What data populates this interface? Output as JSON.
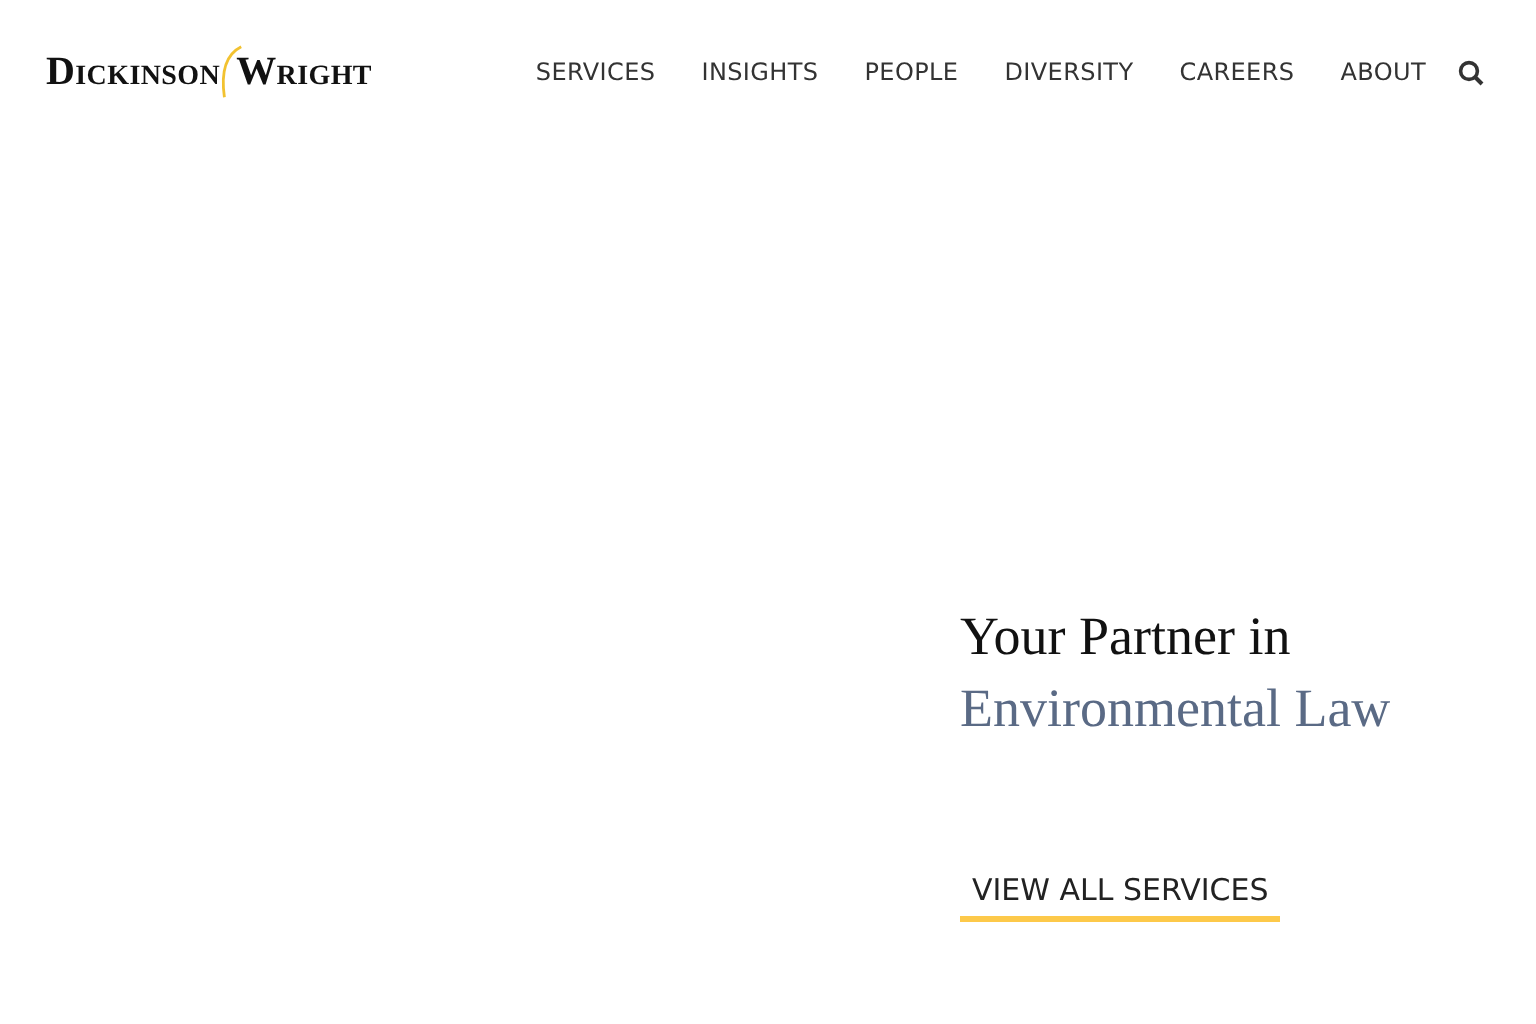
{
  "logo": {
    "words": [
      "DICKINSON",
      "WRIGHT"
    ]
  },
  "nav": {
    "items": [
      "SERVICES",
      "INSIGHTS",
      "PEOPLE",
      "DIVERSITY",
      "CAREERS",
      "ABOUT"
    ]
  },
  "hero": {
    "line_1": "Your Partner in",
    "line_2": "Environmental Law",
    "button": "VIEW ALL SERVICES"
  }
}
